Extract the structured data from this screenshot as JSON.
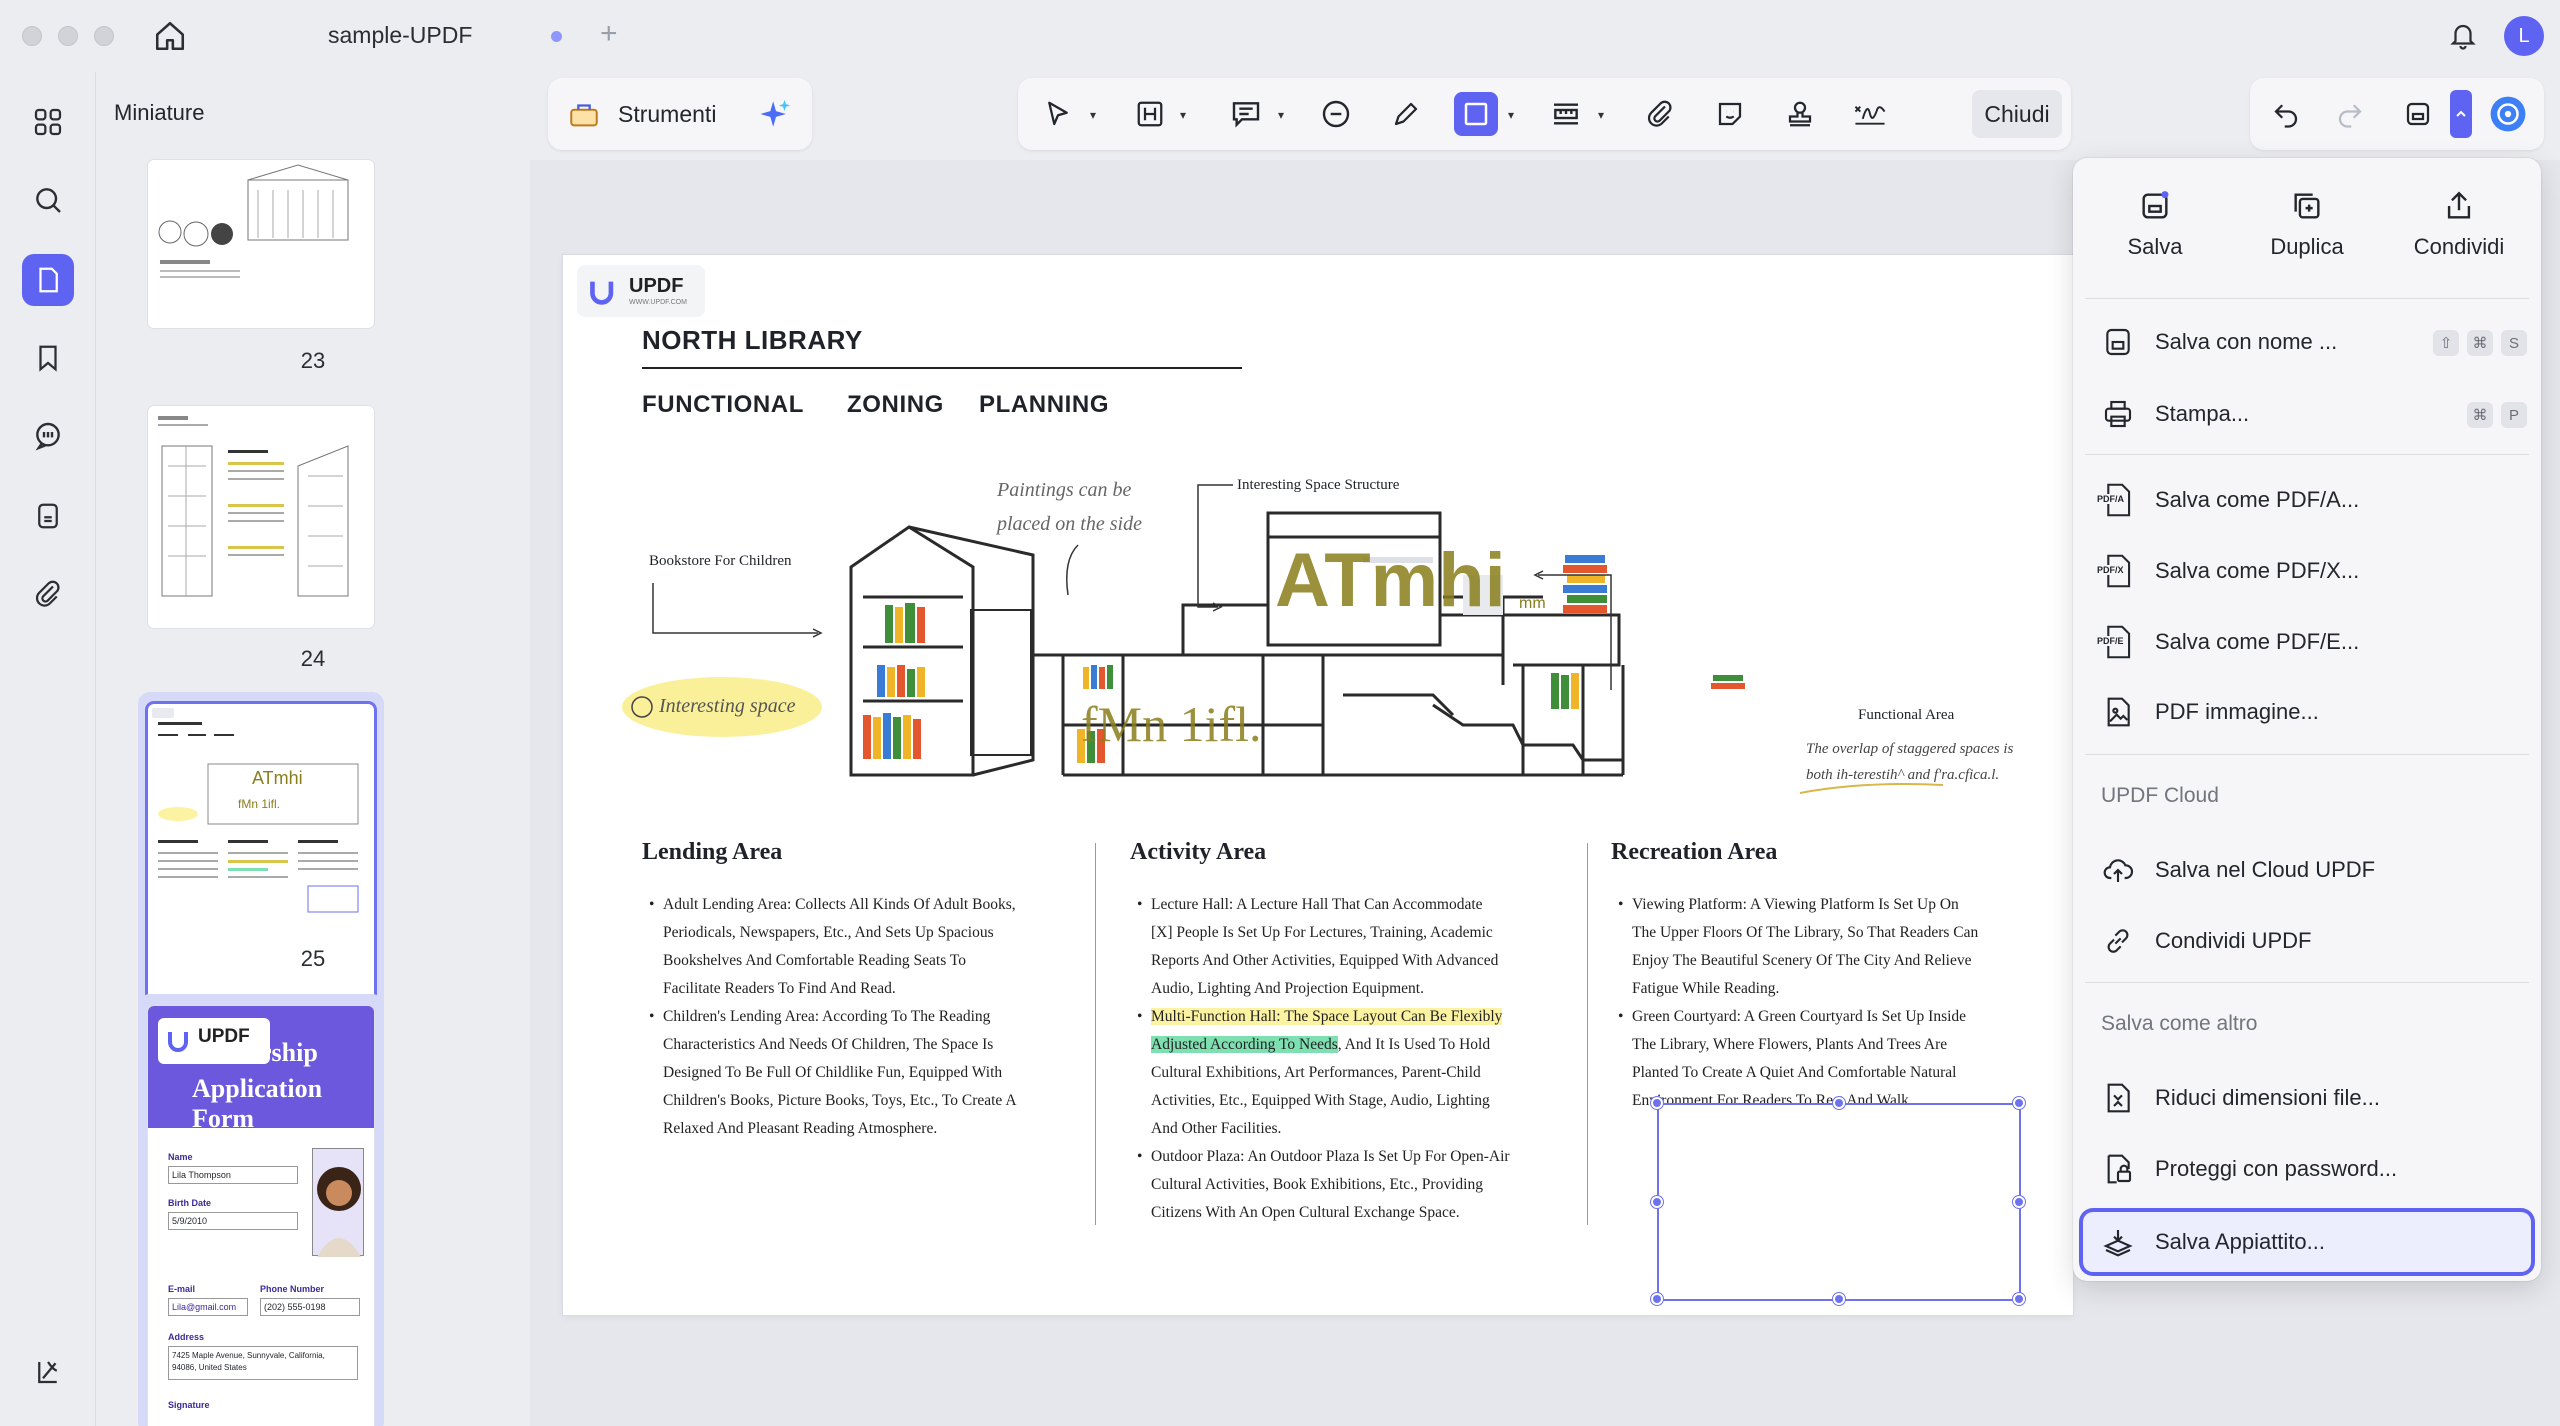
{
  "window": {
    "tab_title": "sample-UPDF",
    "tab_plus": "+",
    "avatar_initial": "L"
  },
  "sidebar": {
    "title": "Miniature",
    "pages": [
      {
        "number": "23"
      },
      {
        "number": "24"
      },
      {
        "number": "25",
        "selected": true
      },
      {
        "number": ""
      }
    ],
    "thumb_form": {
      "logo": "UPDF",
      "title_line1": "rship",
      "title_line2": "Application Form",
      "name_label": "Name",
      "name_value": "Lila Thompson",
      "birth_label": "Birth Date",
      "birth_value": "5/9/2010",
      "email_label": "E-mail",
      "email_value": "Lila@gmail.com",
      "phone_label": "Phone Number",
      "phone_value": "(202) 555-0198",
      "address_label": "Address",
      "address_line1": "7425 Maple Avenue, Sunnyvale, California,",
      "address_line2": "94086, United States",
      "signature_label": "Signature"
    }
  },
  "toolbar": {
    "tools_label": "Strumenti",
    "close_label": "Chiudi"
  },
  "document": {
    "badge_logo": "UPDF",
    "badge_sub": "WWW.UPDF.COM",
    "title": "NORTH LIBRARY",
    "subtitle_words": [
      "FUNCTIONAL",
      "ZONING",
      "PLANNING"
    ],
    "illustration": {
      "label_bookstore": "Bookstore For Children",
      "label_interesting": "Interesting space",
      "label_paintings_1": "Paintings can be",
      "label_paintings_2": "placed on the side",
      "label_structure": "Interesting Space Structure",
      "label_functional": "Functional Area",
      "label_overlap_1": "The overlap of staggered spaces is",
      "label_overlap_2": "both ih-terestih^ and f'ra.cfica.l.",
      "overlay_big": "ATmhi",
      "overlay_small": "mm",
      "overlay_lower": "fMn 1ifl."
    },
    "sections": [
      {
        "title": "Lending Area",
        "lines": [
          {
            "b": true,
            "t": "Adult Lending Area: Collects All Kinds Of Adult Books,"
          },
          {
            "t": "Periodicals, Newspapers, Etc., And Sets Up Spacious"
          },
          {
            "t": "Bookshelves And Comfortable Reading Seats To"
          },
          {
            "t": "Facilitate Readers To Find And Read."
          },
          {
            "b": true,
            "t": "Children's Lending Area: According To The Reading"
          },
          {
            "t": "Characteristics And Needs Of Children, The Space Is"
          },
          {
            "t": "Designed To Be Full Of Childlike Fun, Equipped With"
          },
          {
            "t": "Children's Books, Picture Books, Toys, Etc., To Create A"
          },
          {
            "t": "Relaxed And Pleasant Reading Atmosphere."
          }
        ]
      },
      {
        "title": "Activity Area",
        "lines": [
          {
            "b": true,
            "t": "Lecture Hall: A Lecture Hall That Can Accommodate"
          },
          {
            "t": "[X] People Is Set Up For Lectures, Training, Academic"
          },
          {
            "t": "Reports And Other Activities, Equipped With Advanced"
          },
          {
            "t": "Audio, Lighting And Projection Equipment."
          },
          {
            "b": true,
            "t": "Multi-Function Hall: The Space Layout Can Be Flexibly",
            "hl": "yellow"
          },
          {
            "t": "Adjusted According To Needs",
            "hl": "green",
            "rest": ", And It Is Used To Hold"
          },
          {
            "t": "Cultural Exhibitions, Art Performances, Parent-Child"
          },
          {
            "t": "Activities, Etc., Equipped With Stage, Audio, Lighting"
          },
          {
            "t": "And Other Facilities."
          },
          {
            "b": true,
            "t": "Outdoor Plaza: An Outdoor Plaza Is Set Up For Open-Air"
          },
          {
            "t": "Cultural Activities, Book Exhibitions, Etc., Providing"
          },
          {
            "t": "Citizens With An Open Cultural Exchange Space."
          }
        ]
      },
      {
        "title": "Recreation Area",
        "lines": [
          {
            "b": true,
            "t": "Viewing Platform: A Viewing Platform Is Set Up On"
          },
          {
            "t": "The Upper Floors Of The Library, So That Readers Can"
          },
          {
            "t": "Enjoy The Beautiful Scenery Of The City And Relieve"
          },
          {
            "t": "Fatigue While Reading."
          },
          {
            "b": true,
            "t": "Green Courtyard: A Green Courtyard Is Set Up Inside"
          },
          {
            "t": "The Library, Where Flowers, Plants And Trees Are"
          },
          {
            "t": "Planted To Create A Quiet And Comfortable Natural"
          },
          {
            "t": "Environment For Readers To Rest And Walk."
          }
        ]
      }
    ]
  },
  "menu": {
    "top": [
      {
        "label": "Salva",
        "icon": "save-icon"
      },
      {
        "label": "Duplica",
        "icon": "duplicate-icon"
      },
      {
        "label": "Condividi",
        "icon": "share-icon"
      }
    ],
    "items": [
      {
        "label": "Salva con nome ...",
        "icon": "save-as-icon",
        "shortcut": [
          "⇧",
          "⌘",
          "S"
        ]
      },
      {
        "label": "Stampa...",
        "icon": "print-icon",
        "shortcut": [
          "⌘",
          "P"
        ]
      },
      {
        "label": "Salva come PDF/A...",
        "icon": "pdfa-icon",
        "icon_text": "PDF/A"
      },
      {
        "label": "Salva come PDF/X...",
        "icon": "pdfx-icon",
        "icon_text": "PDF/X"
      },
      {
        "label": "Salva come PDF/E...",
        "icon": "pdfe-icon",
        "icon_text": "PDF/E"
      },
      {
        "label": "PDF immagine...",
        "icon": "image-pdf-icon"
      },
      {
        "label": "Salva nel Cloud UPDF",
        "icon": "cloud-upload-icon"
      },
      {
        "label": "Condividi UPDF",
        "icon": "link-icon"
      },
      {
        "label": "Riduci dimensioni file...",
        "icon": "compress-icon"
      },
      {
        "label": "Proteggi con password...",
        "icon": "lock-shield-icon"
      },
      {
        "label": "Salva Appiattito...",
        "icon": "flatten-icon",
        "highlighted": true
      }
    ],
    "section_cloud": "UPDF Cloud",
    "section_other": "Salva come altro"
  },
  "colors": {
    "accent": "#5f63f2",
    "background": "#ecedf1",
    "highlight_yellow": "#fbf3a2",
    "highlight_green": "#7ee0b1"
  }
}
